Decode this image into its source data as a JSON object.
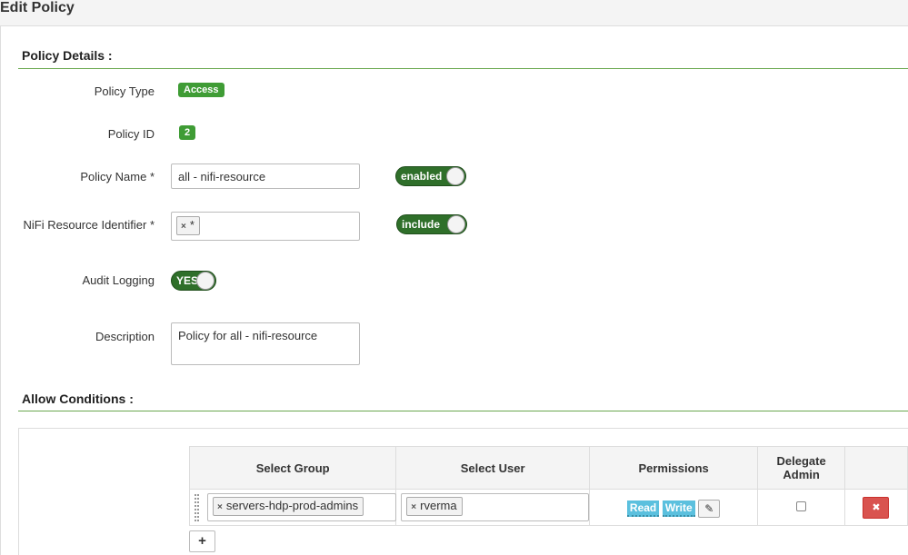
{
  "page": {
    "title": "Edit Policy"
  },
  "policy_details": {
    "section_title": "Policy Details :",
    "policy_type": {
      "label": "Policy Type",
      "value": "Access"
    },
    "policy_id": {
      "label": "Policy ID",
      "value": "2"
    },
    "policy_name": {
      "label": "Policy Name *",
      "value": "all - nifi-resource",
      "toggle": "enabled"
    },
    "resource": {
      "label": "NiFi Resource Identifier *",
      "tag": "*",
      "toggle": "include"
    },
    "audit": {
      "label": "Audit Logging",
      "toggle": "YES"
    },
    "description": {
      "label": "Description",
      "value": "Policy for all - nifi-resource"
    }
  },
  "allow_conditions": {
    "section_title": "Allow Conditions :",
    "columns": {
      "group": "Select Group",
      "user": "Select User",
      "permissions": "Permissions",
      "delegate": "Delegate Admin"
    },
    "rows": [
      {
        "group": "servers-hdp-prod-admins",
        "user": "rverma",
        "permissions": [
          "Read",
          "Write"
        ],
        "delegate_admin": false
      }
    ],
    "add_label": "+"
  },
  "colors": {
    "accent_green": "#3f9c35",
    "toggle_green": "#2f6f2a",
    "permission_blue": "#5bc0de",
    "delete_red": "#d9534f"
  }
}
